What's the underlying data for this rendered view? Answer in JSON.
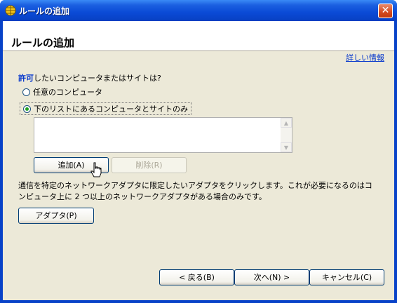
{
  "window": {
    "title": "ルールの追加",
    "close": "✕"
  },
  "header": {
    "title": "ルールの追加"
  },
  "help_link": "詳しい情報",
  "question": {
    "keyword": "許可",
    "rest": "したいコンピュータまたはサイトは?"
  },
  "options": [
    {
      "label": "任意のコンピュータ",
      "selected": false
    },
    {
      "label": "下のリストにあるコンピュータとサイトのみ",
      "selected": true
    }
  ],
  "list": {
    "up": "▲",
    "down": "▼"
  },
  "buttons": {
    "add": "追加(A)",
    "delete": "削除(R)",
    "adapter": "アダプタ(P)"
  },
  "description": "通信を特定のネットワークアダプタに限定したいアダプタをクリックします。これが必要になるのはコンピュータ上に 2 つ以上のネットワークアダプタがある場合のみです。",
  "footer": {
    "back": "< 戻る(B)",
    "next": "次へ(N) >",
    "cancel": "キャンセル(C)"
  }
}
